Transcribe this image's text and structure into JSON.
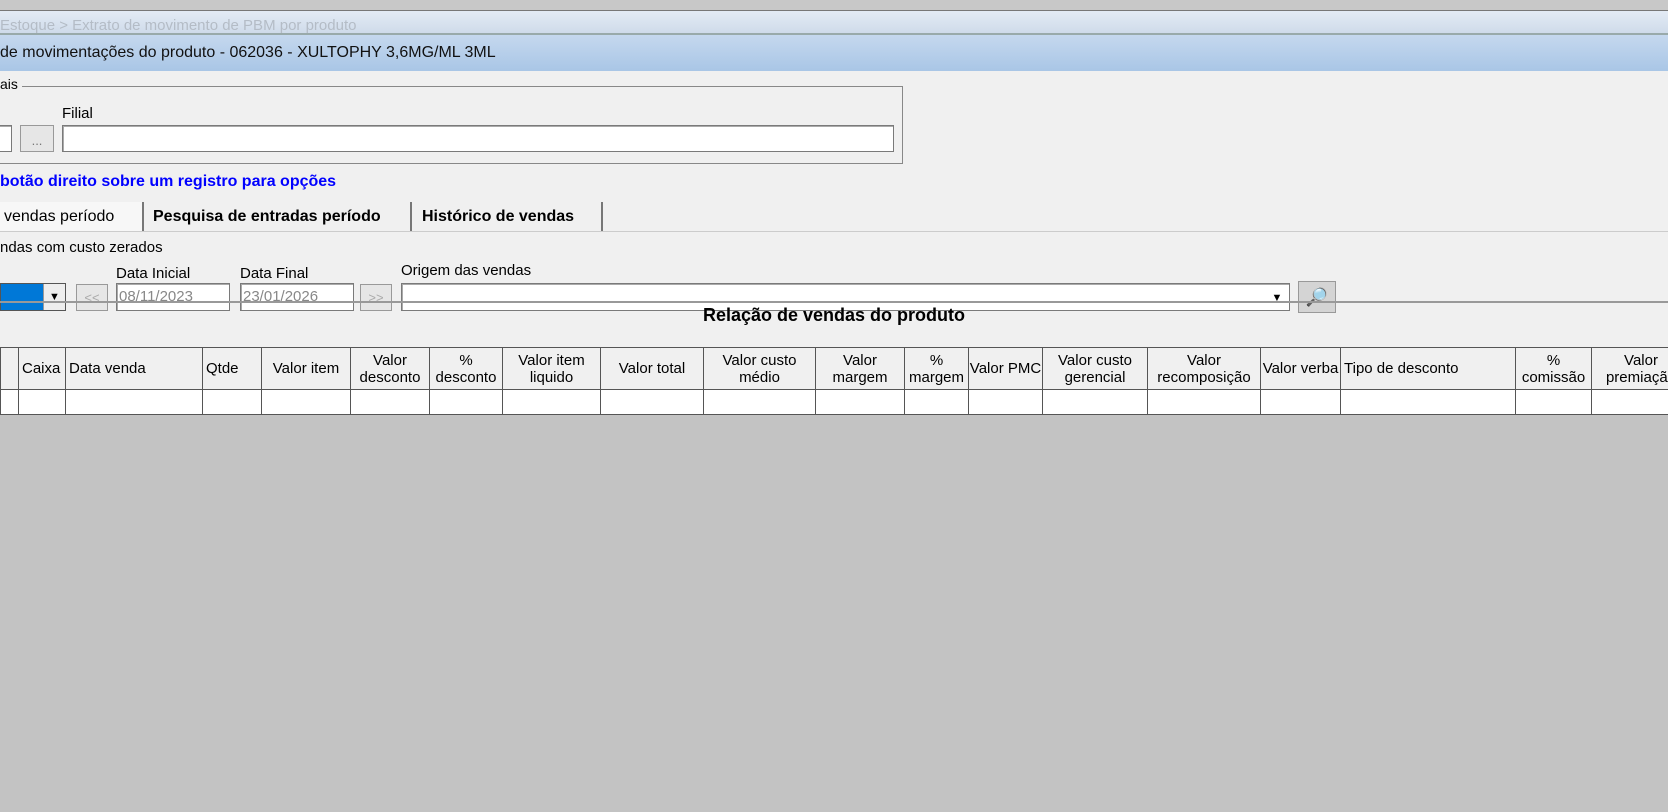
{
  "breadcrumb": "Estoque > Extrato de movimento de PBM por produto",
  "window_title": "de movimentações do produto - 062036 - XULTOPHY 3,6MG/ML 3ML",
  "group": {
    "label": "ais",
    "filial_label": "Filial",
    "filial_value": "",
    "browse_label": "..."
  },
  "hint": "botão direito sobre um registro para opções",
  "tabs": [
    "vendas período",
    "Pesquisa de entradas período",
    "Histórico de vendas"
  ],
  "filters": {
    "checkbox_label": "ndas com custo zerados",
    "data_inicial_label": "Data Inicial",
    "data_inicial": "08/11/2023",
    "data_final_label": "Data Final",
    "data_final": "23/01/2026",
    "prev_label": "<<",
    "next_label": ">>",
    "origem_label": "Origem das vendas",
    "origem_value": ""
  },
  "table": {
    "title": "Relação de vendas do produto",
    "columns": [
      "",
      "Caixa",
      "Data venda",
      "Qtde",
      "Valor item",
      "Valor desconto",
      "% desconto",
      "Valor item liquido",
      "Valor total",
      "Valor custo médio",
      "Valor margem",
      "% margem",
      "Valor PMC",
      "Valor custo gerencial",
      "Valor recomposição",
      "Valor verba",
      "Tipo de desconto",
      "% comissão",
      "Valor premiação"
    ]
  },
  "colors": {
    "hint": "#0000ff",
    "selection": "#0078d7"
  }
}
